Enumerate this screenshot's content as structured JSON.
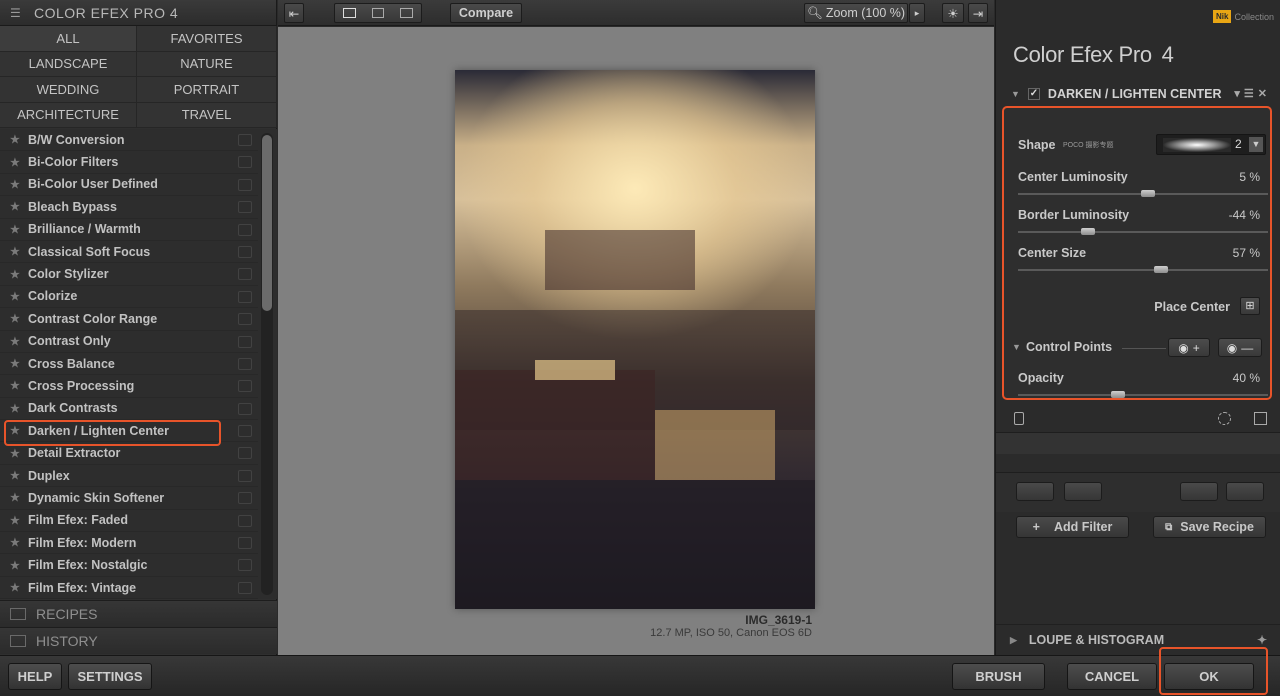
{
  "left_panel": {
    "title": "COLOR EFEX PRO 4",
    "categories": [
      "ALL",
      "FAVORITES",
      "LANDSCAPE",
      "NATURE",
      "WEDDING",
      "PORTRAIT",
      "ARCHITECTURE",
      "TRAVEL"
    ],
    "filters": [
      "B/W Conversion",
      "Bi-Color Filters",
      "Bi-Color User Defined",
      "Bleach Bypass",
      "Brilliance / Warmth",
      "Classical Soft Focus",
      "Color Stylizer",
      "Colorize",
      "Contrast Color Range",
      "Contrast Only",
      "Cross Balance",
      "Cross Processing",
      "Dark Contrasts",
      "Darken / Lighten Center",
      "Detail Extractor",
      "Duplex",
      "Dynamic Skin Softener",
      "Film Efex: Faded",
      "Film Efex: Modern",
      "Film Efex: Nostalgic",
      "Film Efex: Vintage"
    ],
    "selected_filter": "Darken / Lighten Center",
    "recipes_label": "RECIPES",
    "history_label": "HISTORY"
  },
  "toolbar": {
    "compare_label": "Compare",
    "zoom_label": "Zoom (100 %)"
  },
  "preview": {
    "filename": "IMG_3619-1",
    "info": "12.7 MP, ISO 50, Canon EOS 6D"
  },
  "right_panel": {
    "brand_box": "Nik",
    "brand_text": "Collection",
    "app_title": "Color Efex Pro",
    "app_version": "4",
    "filter_name": "DARKEN / LIGHTEN CENTER",
    "shape_label": "Shape",
    "shape_watermark": "POCO 摄影专题",
    "shape_value": "2",
    "controls": [
      {
        "label": "Center Luminosity",
        "value": "5 %",
        "level": 0.52
      },
      {
        "label": "Border Luminosity",
        "value": "-44 %",
        "level": 0.28
      },
      {
        "label": "Center Size",
        "value": "57 %",
        "level": 0.57
      }
    ],
    "place_center_label": "Place Center",
    "control_points_label": "Control Points",
    "opacity_label": "Opacity",
    "opacity_value": "40 %",
    "opacity_level": 0.4,
    "add_filter_label": "Add Filter",
    "save_recipe_label": "Save Recipe",
    "loupe_label": "LOUPE & HISTOGRAM"
  },
  "bottom_bar": {
    "help_label": "HELP",
    "settings_label": "SETTINGS",
    "brush_label": "BRUSH",
    "cancel_label": "CANCEL",
    "ok_label": "OK"
  },
  "colors": {
    "highlight": "#e8542a",
    "brand": "#e9a614"
  }
}
